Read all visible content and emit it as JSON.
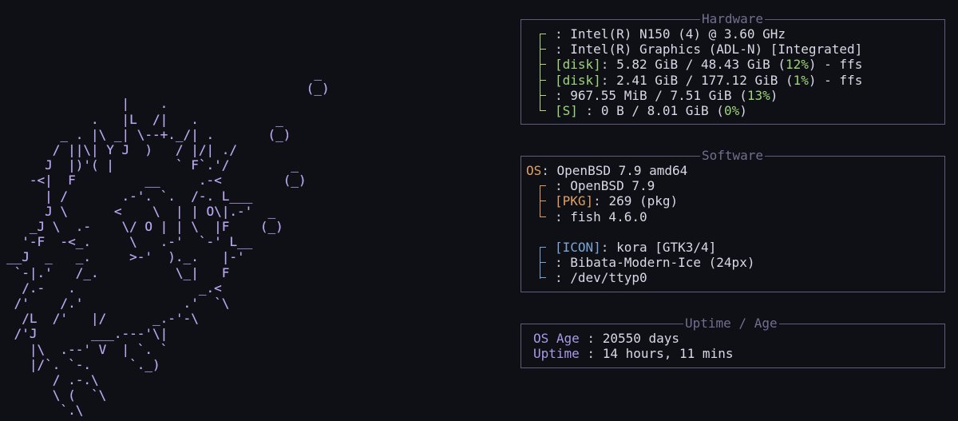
{
  "ascii_art": {
    "lines": [
      "                                        _",
      "                                       (_)",
      "               |    .",
      "           .   |L  /|   .          _",
      "       _ . |\\ _| \\--+._/| .       (_)",
      "      / ||\\| Y J  )   / |/| ./",
      "     J  |)'( |        ` F`.'/        _",
      "   -<|  F         __     .-<        (_)",
      "     | /       .-'. `.  /-. L___",
      "     J \\      <    \\  | | O\\|.-'  _",
      "   _J \\  .-    \\/ O | | \\  |F    (_)",
      "  '-F  -<_.     \\   .-'  `-' L__",
      "__J  _   _.     >-'  )._.   |-'",
      " `-|.'   /_.          \\_|   F",
      "  /.-   .                _.<",
      " /'    /.'             .'  `\\",
      "  /L  /'   |/      _.-'-\\",
      " /'J       ___.---'\\|",
      "   |\\  .--' V  | `. `",
      "   |/`. `-.     `._)",
      "      / .-.\\",
      "      \\ (  `\\",
      "       `.\\"
    ]
  },
  "hardware": {
    "title": "Hardware",
    "rows": [
      {
        "tag": "",
        "key": "",
        "sep": ": ",
        "value": "Intel(R) N150 (4) @ 3.60 GHz"
      },
      {
        "tag": "",
        "key": "",
        "sep": ": ",
        "value": "Intel(R) Graphics (ADL-N) [Integrated]"
      },
      {
        "tag": "[disk]",
        "key": "",
        "sep": ": ",
        "value": "5.82 GiB / 48.43 GiB (",
        "pct": "12%",
        "tail": ") - ffs"
      },
      {
        "tag": "[disk]",
        "key": "",
        "sep": ": ",
        "value": "2.41 GiB / 177.12 GiB (",
        "pct": "1%",
        "tail": ") - ffs"
      },
      {
        "tag": "",
        "key": "",
        "sep": ": ",
        "value": "967.55 MiB / 7.51 GiB (",
        "pct": "13%",
        "tail": ")"
      },
      {
        "tag": "[S]",
        "key": "",
        "sep": " : ",
        "value": "0 B / 8.01 GiB (",
        "pct": "0%",
        "tail": ")"
      }
    ]
  },
  "software": {
    "title": "Software",
    "os_label": "OS",
    "os_value": "OpenBSD 7.9 amd64",
    "group1": [
      {
        "tag": "",
        "sep": ": ",
        "value": "OpenBSD 7.9"
      },
      {
        "tag": "[PKG]",
        "sep": ": ",
        "value": "269 (pkg)"
      },
      {
        "tag": "",
        "sep": ": ",
        "value": "fish 4.6.0"
      }
    ],
    "group2": [
      {
        "tag": "[ICON]",
        "sep": ": ",
        "value": "kora [GTK3/4]"
      },
      {
        "tag": "",
        "sep": ": ",
        "value": "Bibata-Modern-Ice (24px)"
      },
      {
        "tag": "",
        "sep": ": ",
        "value": "/dev/ttyp0"
      }
    ]
  },
  "uptime": {
    "title": "Uptime / Age",
    "rows": [
      {
        "key": "OS Age",
        "sep": " : ",
        "value": "20550 days"
      },
      {
        "key": "Uptime",
        "sep": " : ",
        "value": "14 hours, 11 mins"
      }
    ]
  },
  "colors": {
    "background": "#0f0f16",
    "ascii": "#b8a7ef",
    "border": "#5d5d7d",
    "green": "#9cd678",
    "orange": "#e0a060",
    "blue": "#7aa7d8",
    "purple": "#a99ae6"
  }
}
